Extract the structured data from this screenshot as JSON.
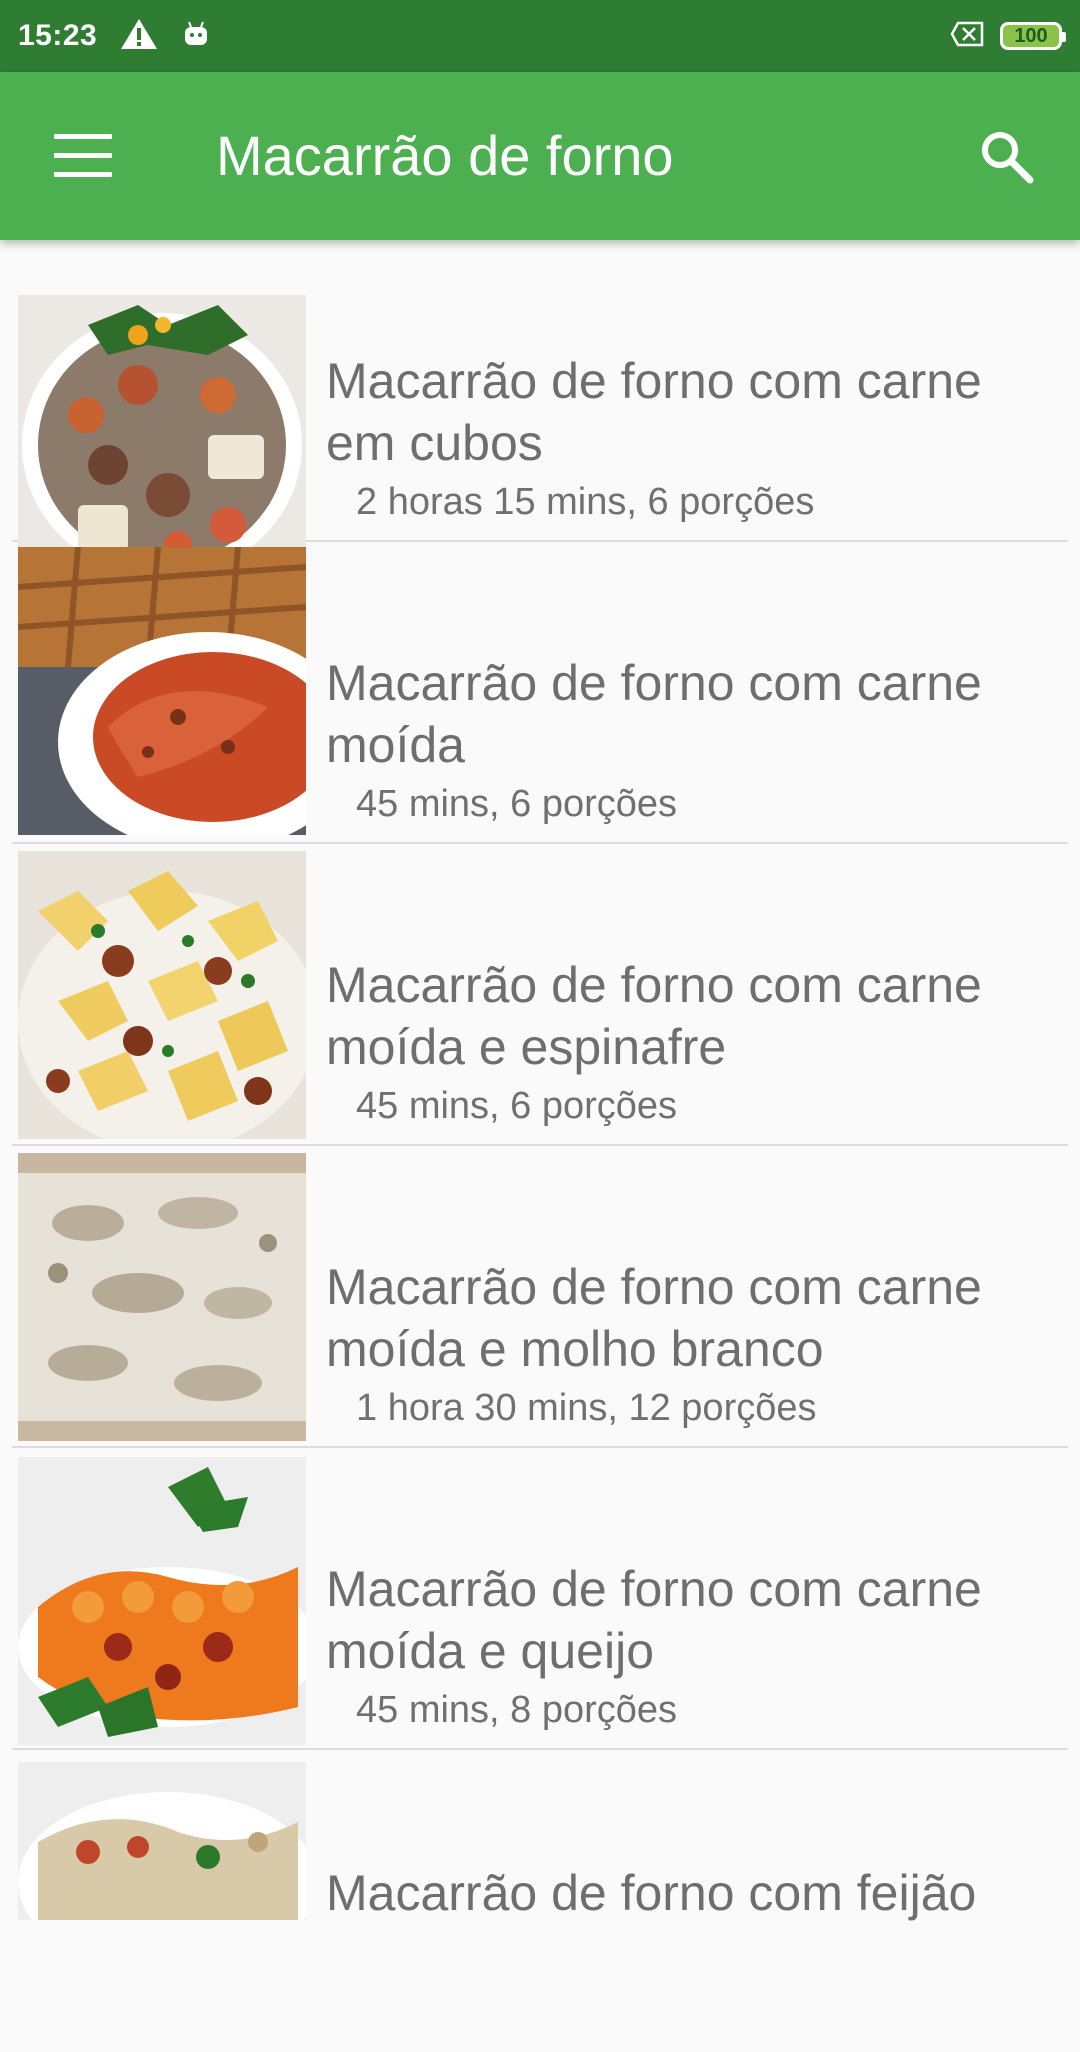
{
  "status_bar": {
    "time": "15:23",
    "icons": [
      "warning-icon",
      "android-icon",
      "no-sim-icon"
    ],
    "battery": "100"
  },
  "app_bar": {
    "title": "Macarrão de forno",
    "menu_icon": "menu-icon",
    "search_icon": "search-icon"
  },
  "recipes": [
    {
      "title_line1": "Macarrão de forno com carne",
      "title_line2": "em cubos",
      "meta": "2 horas 15 mins, 6 porções"
    },
    {
      "title_line1": "Macarrão de forno com carne",
      "title_line2": "moída",
      "meta": "45 mins, 6 porções"
    },
    {
      "title_line1": "Macarrão de forno com carne",
      "title_line2": "moída e espinafre",
      "meta": "45 mins, 6 porções"
    },
    {
      "title_line1": "Macarrão de forno com carne",
      "title_line2": "moída e molho branco",
      "meta": "1 hora 30 mins, 12 porções"
    },
    {
      "title_line1": "Macarrão de forno com carne",
      "title_line2": "moída e queijo",
      "meta": "45 mins, 8 porções"
    },
    {
      "title_line1": "Macarrão de forno com feijão",
      "title_line2": "",
      "meta": ""
    }
  ],
  "colors": {
    "status_bar": "#2e7d32",
    "app_bar": "#4caf50",
    "background": "#fafafa",
    "text": "#6e6e6e"
  }
}
